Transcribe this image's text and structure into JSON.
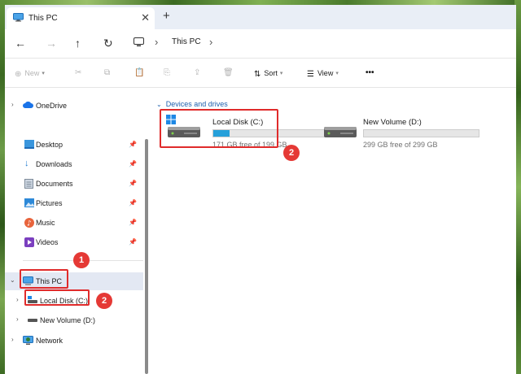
{
  "window": {
    "tab_title": "This PC",
    "tab_close_icon": "close-icon",
    "new_tab_icon": "plus-icon"
  },
  "address_bar": {
    "breadcrumb_label": "This PC",
    "separator": "›"
  },
  "command_bar": {
    "new_label": "New",
    "sort_label": "Sort",
    "view_label": "View",
    "more_label": "•••"
  },
  "nav_pane": {
    "onedrive": "OneDrive",
    "quick_access": [
      {
        "label": "Desktop",
        "icon": "desktop-folder-icon"
      },
      {
        "label": "Downloads",
        "icon": "downloads-folder-icon"
      },
      {
        "label": "Documents",
        "icon": "documents-folder-icon"
      },
      {
        "label": "Pictures",
        "icon": "pictures-folder-icon"
      },
      {
        "label": "Music",
        "icon": "music-folder-icon"
      },
      {
        "label": "Videos",
        "icon": "videos-folder-icon"
      }
    ],
    "this_pc": "This PC",
    "local_disk": "Local Disk (C:)",
    "new_volume": "New Volume (D:)",
    "network": "Network"
  },
  "content": {
    "group_header": "Devices and drives",
    "drives": [
      {
        "name": "Local Disk (C:)",
        "free_text": "171 GB free of 199 GB",
        "used_fraction": 0.14
      },
      {
        "name": "New Volume (D:)",
        "free_text": "299 GB free of 299 GB",
        "used_fraction": 0.0
      }
    ]
  },
  "annotations": {
    "badge_1": "1",
    "badge_2a": "2",
    "badge_2b": "2"
  },
  "colors": {
    "accent": "#26a0da",
    "annotation_red": "#e02b2b",
    "selected_row": "#e3e8f3",
    "group_header": "#1d5fad"
  }
}
